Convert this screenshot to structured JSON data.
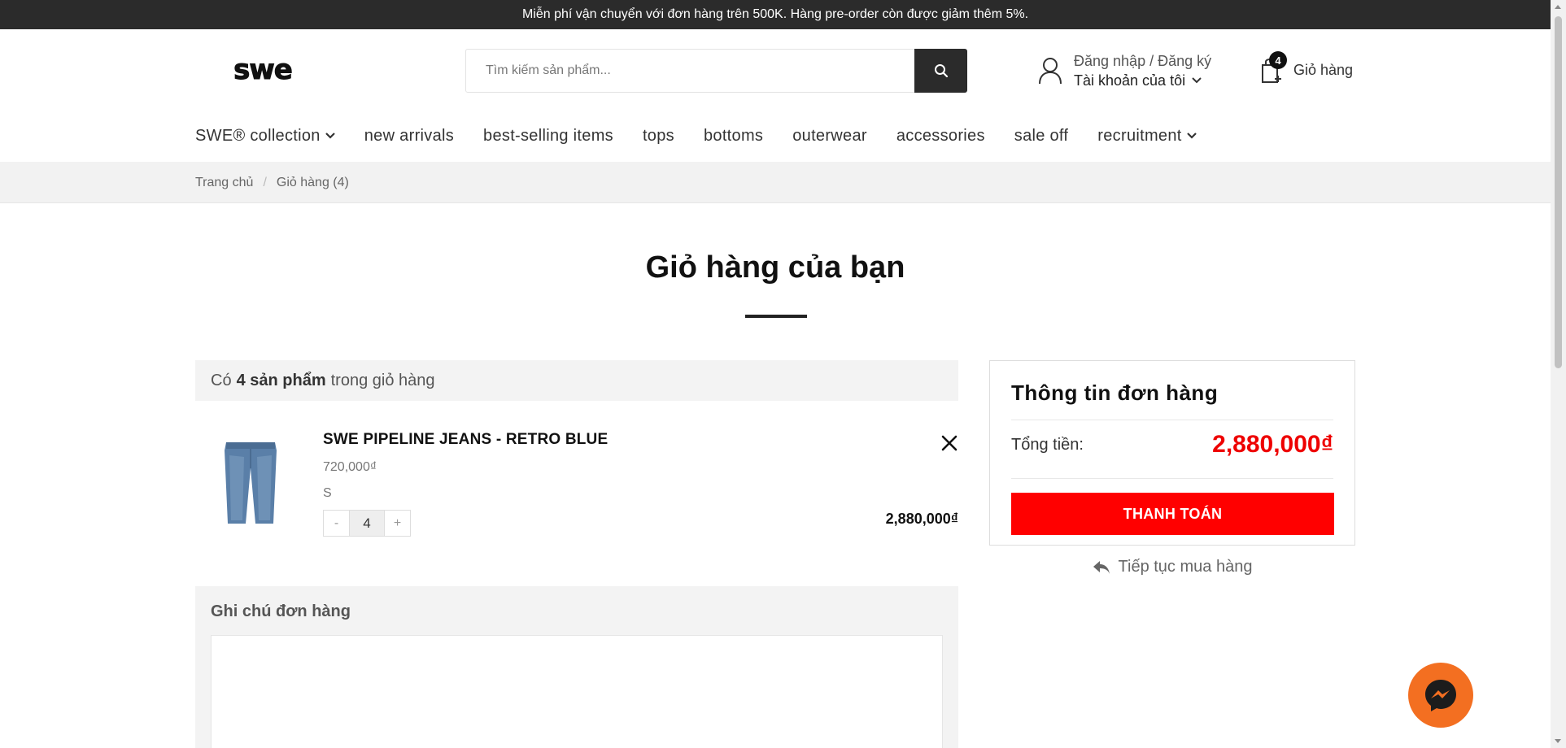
{
  "topbar": {
    "announcement": "Miễn phí vận chuyển với đơn hàng trên 500K. Hàng pre-order còn được giảm thêm 5%."
  },
  "header": {
    "logo_text": "swe",
    "search": {
      "placeholder": "Tìm kiếm sản phẩm..."
    },
    "account": {
      "line1": "Đăng nhập / Đăng ký",
      "line2": "Tài khoản của tôi"
    },
    "cart": {
      "count": "4",
      "label": "Giỏ hàng"
    }
  },
  "nav": {
    "items": [
      {
        "label": "SWE® collection",
        "dropdown": true
      },
      {
        "label": "new arrivals"
      },
      {
        "label": "best-selling items"
      },
      {
        "label": "tops"
      },
      {
        "label": "bottoms"
      },
      {
        "label": "outerwear"
      },
      {
        "label": "accessories"
      },
      {
        "label": "sale off"
      },
      {
        "label": "recruitment",
        "dropdown": true
      }
    ]
  },
  "breadcrumb": {
    "home": "Trang chủ",
    "current": "Giỏ hàng (4)"
  },
  "page_title": "Giỏ hàng của bạn",
  "cart_summary_text": {
    "prefix": "Có",
    "count": "4 sản phẩm",
    "suffix": "trong giỏ hàng"
  },
  "line_item": {
    "name": "SWE PIPELINE JEANS - RETRO BLUE",
    "unit_price": "720,000₫",
    "variant": "S",
    "quantity": "4",
    "minus": "-",
    "plus": "+",
    "line_total": "2,880,000₫"
  },
  "note": {
    "label": "Ghi chú đơn hàng"
  },
  "order_info": {
    "heading": "Thông tin đơn hàng",
    "total_label": "Tổng tiền:",
    "total_value": "2,880,000₫",
    "checkout_label": "THANH TOÁN"
  },
  "continue_shopping": "Tiếp tục mua hàng",
  "colors": {
    "accent_red": "#ff0000",
    "price_red": "#ee0000",
    "dark": "#2b2b2b",
    "messenger_orange": "#f36f21"
  },
  "icons": [
    "search-icon",
    "user-icon",
    "chevron-down-icon",
    "shopping-bag-icon",
    "close-icon",
    "reply-arrow-icon",
    "messenger-icon"
  ]
}
